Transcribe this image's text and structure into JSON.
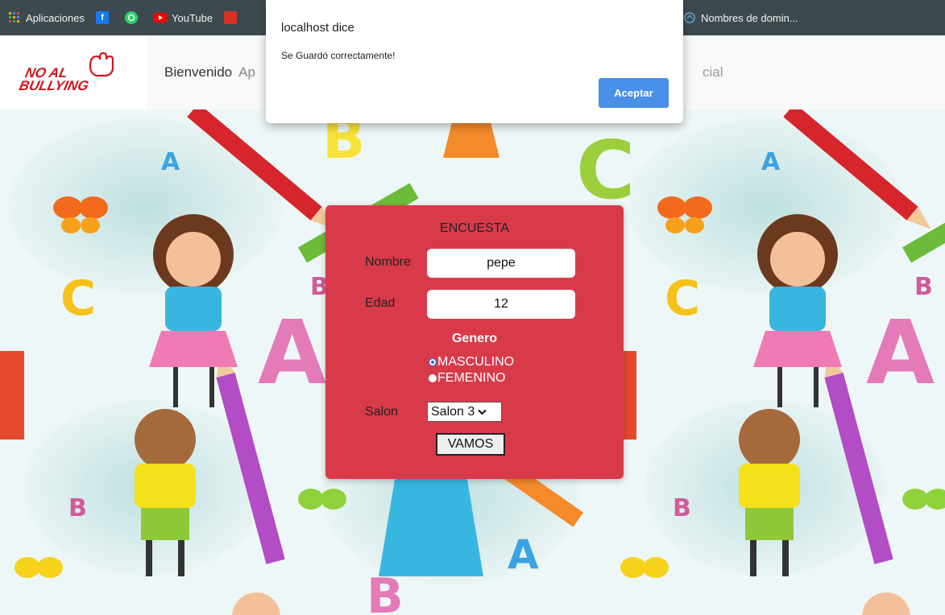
{
  "bookmarks": [
    {
      "label": "Aplicaciones",
      "icon": "apps-grid-icon"
    },
    {
      "label": "",
      "icon": "facebook-icon"
    },
    {
      "label": "",
      "icon": "whatsapp-icon"
    },
    {
      "label": "YouTube",
      "icon": "youtube-icon"
    }
  ],
  "bookmark_right": {
    "label": "Nombres de domin...",
    "icon": "globe-icon"
  },
  "nav": {
    "logo_text_1": "NO AL",
    "logo_text_2": "BULLYING",
    "link_1": "Bienvenido",
    "link_2": "Ap",
    "link_right": "cial"
  },
  "dialog": {
    "title": "localhost dice",
    "message": "Se Guardó correctamente!",
    "button": "Aceptar"
  },
  "survey": {
    "title": "ENCUESTA",
    "nombre_label": "Nombre",
    "nombre_value": "pepe",
    "edad_label": "Edad",
    "edad_value": "12",
    "genero_label": "Genero",
    "option_1": "MASCULINO",
    "option_2": "FEMENINO",
    "selected_option": "MASCULINO",
    "salon_label": "Salon",
    "salon_value": "Salon 3",
    "submit": "VAMOS"
  },
  "colors": {
    "card": "#d93a4a",
    "dialog_button": "#4a8fe8",
    "bookmarks_bar": "#3c4a4f"
  }
}
